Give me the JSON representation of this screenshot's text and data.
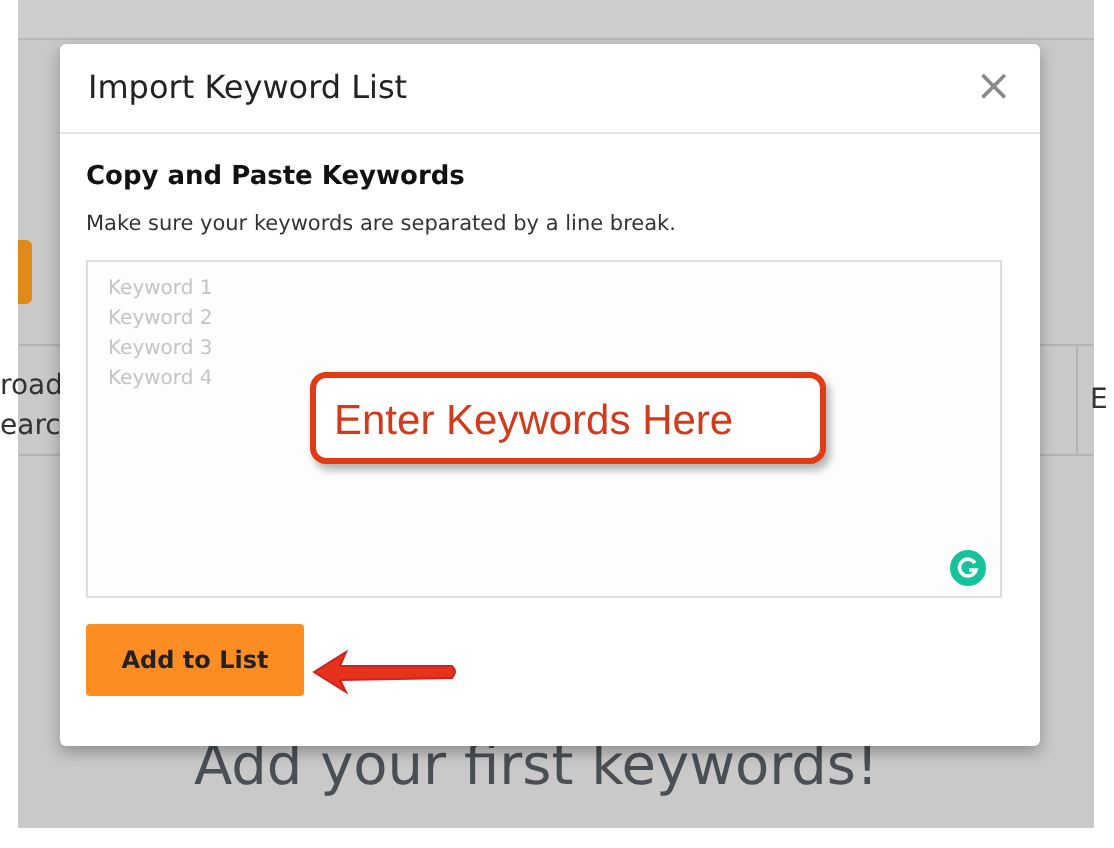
{
  "background": {
    "column_1_lines": [
      "road",
      "earc"
    ],
    "column_2_text": "E",
    "empty_message": "Add your first keywords!"
  },
  "modal": {
    "title": "Import Keyword List",
    "close": "×",
    "section_title": "Copy and Paste Keywords",
    "hint": "Make sure your keywords are separated by a line break.",
    "keywords_field": {
      "placeholder": "Keyword 1\nKeyword 2\nKeyword 3\nKeyword 4"
    },
    "submit_button": "Add to List"
  },
  "annotations": [
    {
      "kind": "callout",
      "text": "Enter Keywords Here"
    },
    {
      "kind": "arrow"
    }
  ]
}
